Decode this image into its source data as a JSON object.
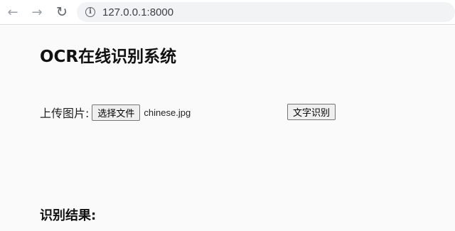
{
  "browser": {
    "back_glyph": "←",
    "forward_glyph": "→",
    "reload_glyph": "↻",
    "info_glyph": "i",
    "url": "127.0.0.1:8000"
  },
  "page": {
    "title": "OCR在线识别系统",
    "upload_label": "上传图片:",
    "choose_file_button": "选择文件",
    "file_name": "chinese.jpg",
    "ocr_button": "文字识别",
    "result_heading": "识别结果:"
  }
}
